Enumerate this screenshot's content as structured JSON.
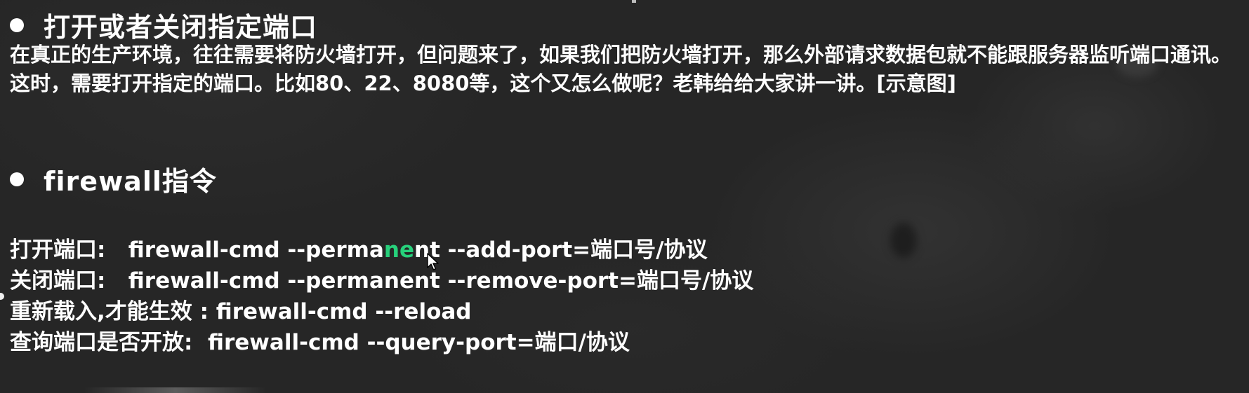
{
  "section1": {
    "heading": "打开或者关闭指定端口",
    "paragraph": "在真正的生产环境，往往需要将防火墙打开，但问题来了，如果我们把防火墙打开，那么外部请求数据包就不能跟服务器监听端口通讯。这时，需要打开指定的端口。比如80、22、8080等，这个又怎么做呢？老韩给给大家讲一讲。[示意图]"
  },
  "section2": {
    "heading": "firewall指令"
  },
  "commands": [
    {
      "label": "打开端口:",
      "cmd_before": "firewall-cmd --perma",
      "cmd_highlight": "ne",
      "cmd_after": "nt --add-port=端口号/协议"
    },
    {
      "label": "关闭端口:",
      "cmd": "firewall-cmd --permanent --remove-port=端口号/协议"
    },
    {
      "label": "重新载入,才能生效 :",
      "cmd": "firewall-cmd --reload"
    },
    {
      "label": "查询端口是否开放:",
      "cmd": "firewall-cmd --query-port=端口/协议"
    }
  ],
  "colors": {
    "background": "#262626",
    "text": "#ffffff",
    "highlight": "#27d07b"
  }
}
